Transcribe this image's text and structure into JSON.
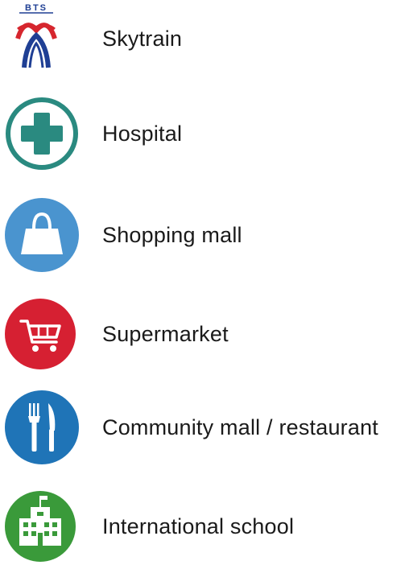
{
  "legend": {
    "items": [
      {
        "label": "Skytrain",
        "icon": "bts-skytrain-logo-icon",
        "logo_text": "BTS",
        "colors": [
          "#d6262e",
          "#1f3f94"
        ]
      },
      {
        "label": "Hospital",
        "icon": "hospital-cross-icon",
        "color": "#2a8a80"
      },
      {
        "label": "Shopping mall",
        "icon": "shopping-bag-icon",
        "color": "#4a94cf"
      },
      {
        "label": "Supermarket",
        "icon": "shopping-cart-icon",
        "color": "#d62032"
      },
      {
        "label": "Community mall / restaurant",
        "icon": "fork-knife-icon",
        "color": "#1f74b7"
      },
      {
        "label": "International school",
        "icon": "school-building-icon",
        "color": "#3a9a3a"
      }
    ]
  }
}
